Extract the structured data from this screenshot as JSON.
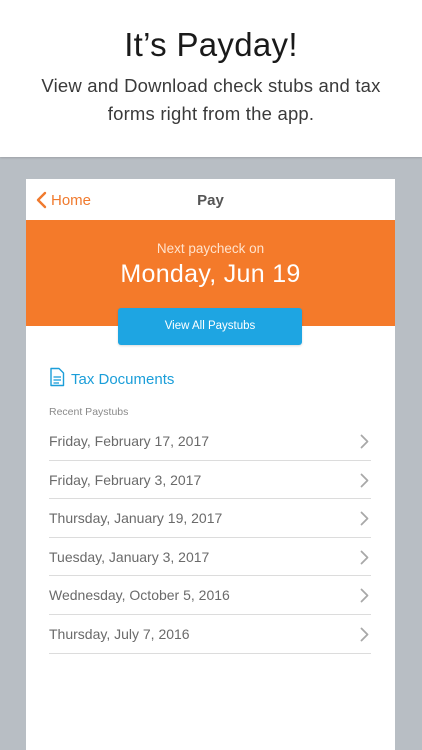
{
  "promo": {
    "title": "It’s Payday!",
    "subtitle": "View and Download check stubs and tax forms right from the app."
  },
  "navbar": {
    "back_label": "Home",
    "title": "Pay"
  },
  "hero": {
    "label": "Next paycheck on",
    "date": "Monday, Jun 19",
    "button_label": "View All Paystubs"
  },
  "tax_documents": {
    "label": "Tax Documents",
    "icon": "document-icon"
  },
  "paystubs": {
    "section_label": "Recent Paystubs",
    "items": [
      {
        "label": "Friday, February 17, 2017"
      },
      {
        "label": "Friday, February 3, 2017"
      },
      {
        "label": "Thursday, January 19, 2017"
      },
      {
        "label": "Tuesday, January 3, 2017"
      },
      {
        "label": "Wednesday, October 5, 2016"
      },
      {
        "label": "Thursday, July 7, 2016"
      }
    ]
  },
  "colors": {
    "accent_orange": "#f47a2a",
    "accent_blue": "#1ea5e2",
    "background_gray": "#b8bec4"
  }
}
